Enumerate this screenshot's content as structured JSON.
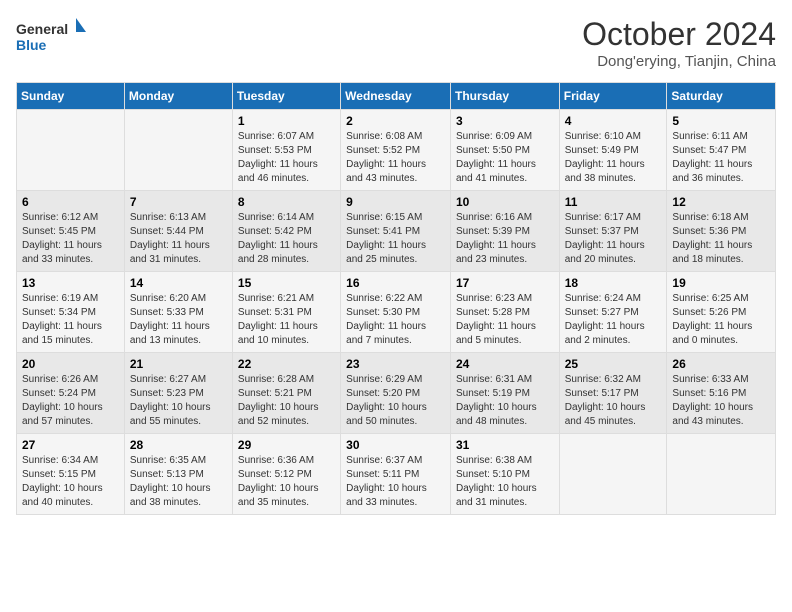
{
  "header": {
    "logo_text_general": "General",
    "logo_text_blue": "Blue",
    "month_title": "October 2024",
    "location": "Dong'erying, Tianjin, China"
  },
  "days_of_week": [
    "Sunday",
    "Monday",
    "Tuesday",
    "Wednesday",
    "Thursday",
    "Friday",
    "Saturday"
  ],
  "weeks": [
    [
      {
        "day": "",
        "sunrise": "",
        "sunset": "",
        "daylight": ""
      },
      {
        "day": "",
        "sunrise": "",
        "sunset": "",
        "daylight": ""
      },
      {
        "day": "1",
        "sunrise": "Sunrise: 6:07 AM",
        "sunset": "Sunset: 5:53 PM",
        "daylight": "Daylight: 11 hours and 46 minutes."
      },
      {
        "day": "2",
        "sunrise": "Sunrise: 6:08 AM",
        "sunset": "Sunset: 5:52 PM",
        "daylight": "Daylight: 11 hours and 43 minutes."
      },
      {
        "day": "3",
        "sunrise": "Sunrise: 6:09 AM",
        "sunset": "Sunset: 5:50 PM",
        "daylight": "Daylight: 11 hours and 41 minutes."
      },
      {
        "day": "4",
        "sunrise": "Sunrise: 6:10 AM",
        "sunset": "Sunset: 5:49 PM",
        "daylight": "Daylight: 11 hours and 38 minutes."
      },
      {
        "day": "5",
        "sunrise": "Sunrise: 6:11 AM",
        "sunset": "Sunset: 5:47 PM",
        "daylight": "Daylight: 11 hours and 36 minutes."
      }
    ],
    [
      {
        "day": "6",
        "sunrise": "Sunrise: 6:12 AM",
        "sunset": "Sunset: 5:45 PM",
        "daylight": "Daylight: 11 hours and 33 minutes."
      },
      {
        "day": "7",
        "sunrise": "Sunrise: 6:13 AM",
        "sunset": "Sunset: 5:44 PM",
        "daylight": "Daylight: 11 hours and 31 minutes."
      },
      {
        "day": "8",
        "sunrise": "Sunrise: 6:14 AM",
        "sunset": "Sunset: 5:42 PM",
        "daylight": "Daylight: 11 hours and 28 minutes."
      },
      {
        "day": "9",
        "sunrise": "Sunrise: 6:15 AM",
        "sunset": "Sunset: 5:41 PM",
        "daylight": "Daylight: 11 hours and 25 minutes."
      },
      {
        "day": "10",
        "sunrise": "Sunrise: 6:16 AM",
        "sunset": "Sunset: 5:39 PM",
        "daylight": "Daylight: 11 hours and 23 minutes."
      },
      {
        "day": "11",
        "sunrise": "Sunrise: 6:17 AM",
        "sunset": "Sunset: 5:37 PM",
        "daylight": "Daylight: 11 hours and 20 minutes."
      },
      {
        "day": "12",
        "sunrise": "Sunrise: 6:18 AM",
        "sunset": "Sunset: 5:36 PM",
        "daylight": "Daylight: 11 hours and 18 minutes."
      }
    ],
    [
      {
        "day": "13",
        "sunrise": "Sunrise: 6:19 AM",
        "sunset": "Sunset: 5:34 PM",
        "daylight": "Daylight: 11 hours and 15 minutes."
      },
      {
        "day": "14",
        "sunrise": "Sunrise: 6:20 AM",
        "sunset": "Sunset: 5:33 PM",
        "daylight": "Daylight: 11 hours and 13 minutes."
      },
      {
        "day": "15",
        "sunrise": "Sunrise: 6:21 AM",
        "sunset": "Sunset: 5:31 PM",
        "daylight": "Daylight: 11 hours and 10 minutes."
      },
      {
        "day": "16",
        "sunrise": "Sunrise: 6:22 AM",
        "sunset": "Sunset: 5:30 PM",
        "daylight": "Daylight: 11 hours and 7 minutes."
      },
      {
        "day": "17",
        "sunrise": "Sunrise: 6:23 AM",
        "sunset": "Sunset: 5:28 PM",
        "daylight": "Daylight: 11 hours and 5 minutes."
      },
      {
        "day": "18",
        "sunrise": "Sunrise: 6:24 AM",
        "sunset": "Sunset: 5:27 PM",
        "daylight": "Daylight: 11 hours and 2 minutes."
      },
      {
        "day": "19",
        "sunrise": "Sunrise: 6:25 AM",
        "sunset": "Sunset: 5:26 PM",
        "daylight": "Daylight: 11 hours and 0 minutes."
      }
    ],
    [
      {
        "day": "20",
        "sunrise": "Sunrise: 6:26 AM",
        "sunset": "Sunset: 5:24 PM",
        "daylight": "Daylight: 10 hours and 57 minutes."
      },
      {
        "day": "21",
        "sunrise": "Sunrise: 6:27 AM",
        "sunset": "Sunset: 5:23 PM",
        "daylight": "Daylight: 10 hours and 55 minutes."
      },
      {
        "day": "22",
        "sunrise": "Sunrise: 6:28 AM",
        "sunset": "Sunset: 5:21 PM",
        "daylight": "Daylight: 10 hours and 52 minutes."
      },
      {
        "day": "23",
        "sunrise": "Sunrise: 6:29 AM",
        "sunset": "Sunset: 5:20 PM",
        "daylight": "Daylight: 10 hours and 50 minutes."
      },
      {
        "day": "24",
        "sunrise": "Sunrise: 6:31 AM",
        "sunset": "Sunset: 5:19 PM",
        "daylight": "Daylight: 10 hours and 48 minutes."
      },
      {
        "day": "25",
        "sunrise": "Sunrise: 6:32 AM",
        "sunset": "Sunset: 5:17 PM",
        "daylight": "Daylight: 10 hours and 45 minutes."
      },
      {
        "day": "26",
        "sunrise": "Sunrise: 6:33 AM",
        "sunset": "Sunset: 5:16 PM",
        "daylight": "Daylight: 10 hours and 43 minutes."
      }
    ],
    [
      {
        "day": "27",
        "sunrise": "Sunrise: 6:34 AM",
        "sunset": "Sunset: 5:15 PM",
        "daylight": "Daylight: 10 hours and 40 minutes."
      },
      {
        "day": "28",
        "sunrise": "Sunrise: 6:35 AM",
        "sunset": "Sunset: 5:13 PM",
        "daylight": "Daylight: 10 hours and 38 minutes."
      },
      {
        "day": "29",
        "sunrise": "Sunrise: 6:36 AM",
        "sunset": "Sunset: 5:12 PM",
        "daylight": "Daylight: 10 hours and 35 minutes."
      },
      {
        "day": "30",
        "sunrise": "Sunrise: 6:37 AM",
        "sunset": "Sunset: 5:11 PM",
        "daylight": "Daylight: 10 hours and 33 minutes."
      },
      {
        "day": "31",
        "sunrise": "Sunrise: 6:38 AM",
        "sunset": "Sunset: 5:10 PM",
        "daylight": "Daylight: 10 hours and 31 minutes."
      },
      {
        "day": "",
        "sunrise": "",
        "sunset": "",
        "daylight": ""
      },
      {
        "day": "",
        "sunrise": "",
        "sunset": "",
        "daylight": ""
      }
    ]
  ]
}
